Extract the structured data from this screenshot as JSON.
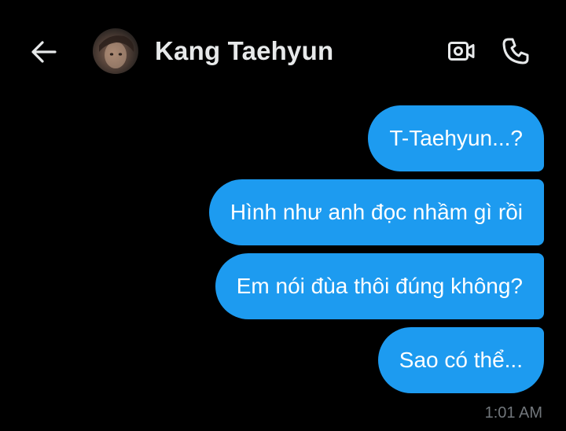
{
  "header": {
    "back_icon": "arrow-left-icon",
    "contact_name": "Kang Taehyun",
    "avatar": "contact-avatar",
    "video_icon": "video-camera-icon",
    "phone_icon": "phone-icon"
  },
  "messages": [
    {
      "text": "T-Taehyun...?",
      "sender": "self"
    },
    {
      "text": "Hình như anh đọc nhầm gì rồi",
      "sender": "self"
    },
    {
      "text": "Em nói đùa thôi đúng không?",
      "sender": "self"
    },
    {
      "text": "Sao có thể...",
      "sender": "self"
    }
  ],
  "timestamp": "1:01 AM",
  "colors": {
    "background": "#000000",
    "bubble": "#1d9bf0",
    "bubble_text": "#ffffff",
    "name_text": "#e7e9ea",
    "timestamp_text": "#71767b"
  }
}
